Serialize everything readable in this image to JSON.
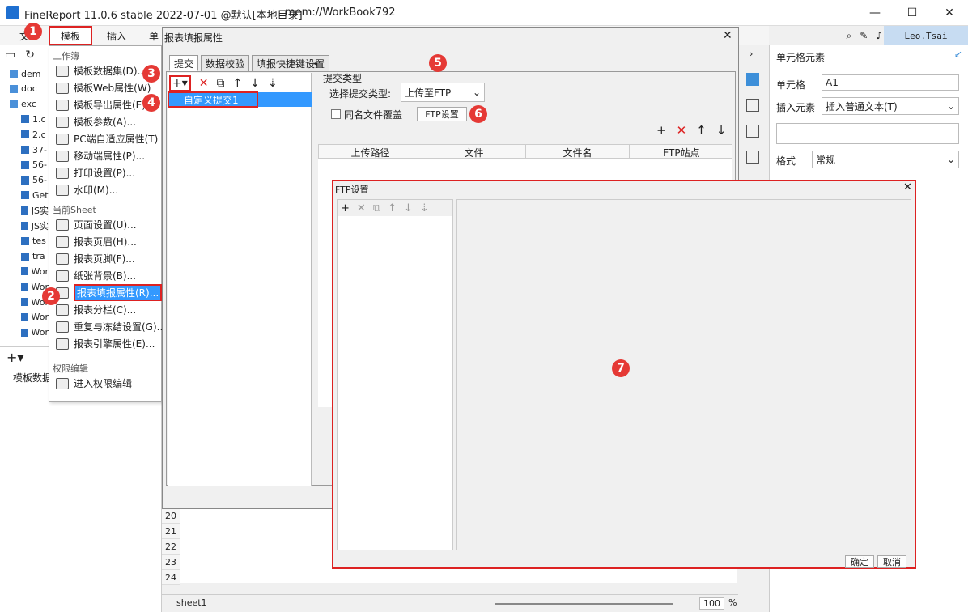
{
  "window": {
    "title": "FineReport 11.0.6 stable 2022-07-01 @默认[本地目录]",
    "workbook": "mem://WorkBook792",
    "user": "Leo.Tsai"
  },
  "menubar": {
    "file": "文",
    "template": "模板",
    "insert": "插入",
    "cell": "单"
  },
  "tree": {
    "items": [
      "dem",
      "doc",
      "exc",
      "1.c",
      "2.c",
      "37-",
      "56-",
      "56-",
      "Get",
      "JS实",
      "JS实",
      "tes",
      "tra",
      "Wor",
      "Wor",
      "Wor",
      "Wor",
      "Wor"
    ]
  },
  "template_menu": {
    "workbook_header": "工作簿",
    "sheet_header": "当前Sheet",
    "perm_header": "权限编辑",
    "items": [
      "模板数据集(D)...",
      "模板Web属性(W)",
      "模板导出属性(E)",
      "模板参数(A)...",
      "PC端自适应属性(T)",
      "移动端属性(P)...",
      "打印设置(P)...",
      "水印(M)..."
    ],
    "sheet_items": [
      "页面设置(U)...",
      "报表页眉(H)...",
      "报表页脚(F)...",
      "纸张背景(B)...",
      "报表填报属性(R)...",
      "报表分栏(C)...",
      "重复与冻结设置(G)...",
      "报表引擎属性(E)..."
    ],
    "perm_items": [
      "进入权限编辑"
    ]
  },
  "left_bottom": {
    "label": "模板数据"
  },
  "dialog": {
    "title": "报表填报属性",
    "tabs": [
      "提交",
      "数据校验",
      "填报快捷键设置"
    ],
    "submit_item": "自定义提交1",
    "submit_type_header": "提交类型",
    "select_label": "选择提交类型:",
    "select_value": "上传至FTP",
    "overwrite_label": "同名文件覆盖",
    "ftp_settings_button": "FTP设置",
    "columns": [
      "上传路径",
      "文件",
      "文件名",
      "FTP站点"
    ]
  },
  "ftp_dialog": {
    "title": "FTP设置",
    "ok": "确定",
    "cancel": "取消"
  },
  "right_panel": {
    "title": "单元格元素",
    "cell_label": "单元格",
    "cell_value": "A1",
    "insert_label": "插入元素",
    "insert_value": "插入普通文本(T)",
    "format_label": "格式",
    "format_value": "常规"
  },
  "grid": {
    "rows": [
      "20",
      "21",
      "22",
      "23",
      "24"
    ]
  },
  "statusbar": {
    "sheet": "sheet1",
    "zoom": "100",
    "percent": "%"
  },
  "badges": [
    "1",
    "2",
    "3",
    "4",
    "5",
    "6",
    "7"
  ],
  "colors": {
    "accent": "#3d8fd9",
    "highlight": "#3399ff",
    "annotation": "#e53935"
  }
}
